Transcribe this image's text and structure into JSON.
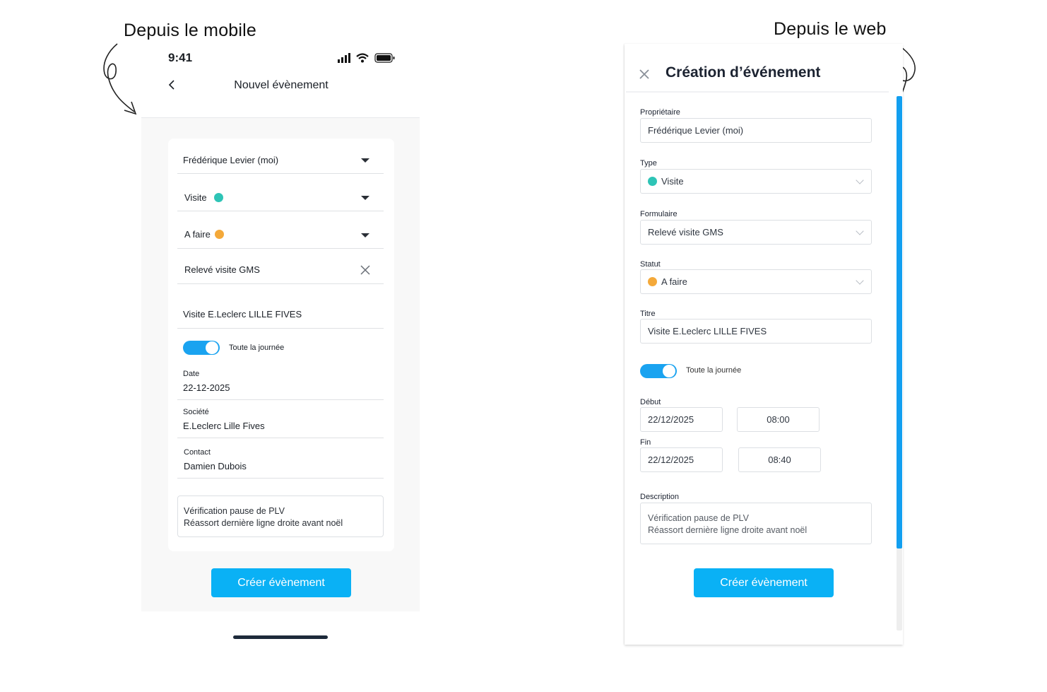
{
  "captions": {
    "mobile": "Depuis le mobile",
    "web": "Depuis le web"
  },
  "mobile": {
    "status_time": "9:41",
    "header_title": "Nouvel évènement",
    "owner": "Frédérique Levier (moi)",
    "type": {
      "label": "Visite",
      "color": "#2ec4b6"
    },
    "status": {
      "label": "A faire",
      "color": "#f4a93a"
    },
    "form": "Relevé visite GMS",
    "title": "Visite E.Leclerc LILLE FIVES",
    "all_day": {
      "label": "Toute la journée",
      "on": true
    },
    "date": {
      "label": "Date",
      "value": "22-12-2025"
    },
    "company": {
      "label": "Société",
      "value": "E.Leclerc Lille Fives"
    },
    "contact": {
      "label": "Contact",
      "value": "Damien Dubois"
    },
    "description": {
      "line1": "Vérification pause de PLV",
      "line2": "Réassort dernière ligne droite avant noël"
    },
    "submit_label": "Créer évènement"
  },
  "web": {
    "title": "Création d’événement",
    "owner": {
      "label": "Propriétaire",
      "value": "Frédérique Levier (moi)"
    },
    "type": {
      "label": "Type",
      "value": "Visite",
      "color": "#2ec4b6"
    },
    "form": {
      "label": "Formulaire",
      "value": "Relevé visite GMS"
    },
    "status": {
      "label": "Statut",
      "value": "A faire",
      "color": "#f4a93a"
    },
    "event_title": {
      "label": "Titre",
      "value": "Visite E.Leclerc LILLE FIVES"
    },
    "all_day": {
      "label": "Toute la journée",
      "on": true
    },
    "start": {
      "label": "Début",
      "date": "22/12/2025",
      "time": "08:00"
    },
    "end": {
      "label": "Fin",
      "date": "22/12/2025",
      "time": "08:40"
    },
    "description": {
      "label": "Description",
      "line1": "Vérification pause de PLV",
      "line2": "Réassort dernière ligne droite avant noël"
    },
    "submit_label": "Créer évènement"
  },
  "colors": {
    "accent": "#0ab1f5",
    "toggle": "#1aa3f0",
    "scrollbar": "#129ff0"
  }
}
